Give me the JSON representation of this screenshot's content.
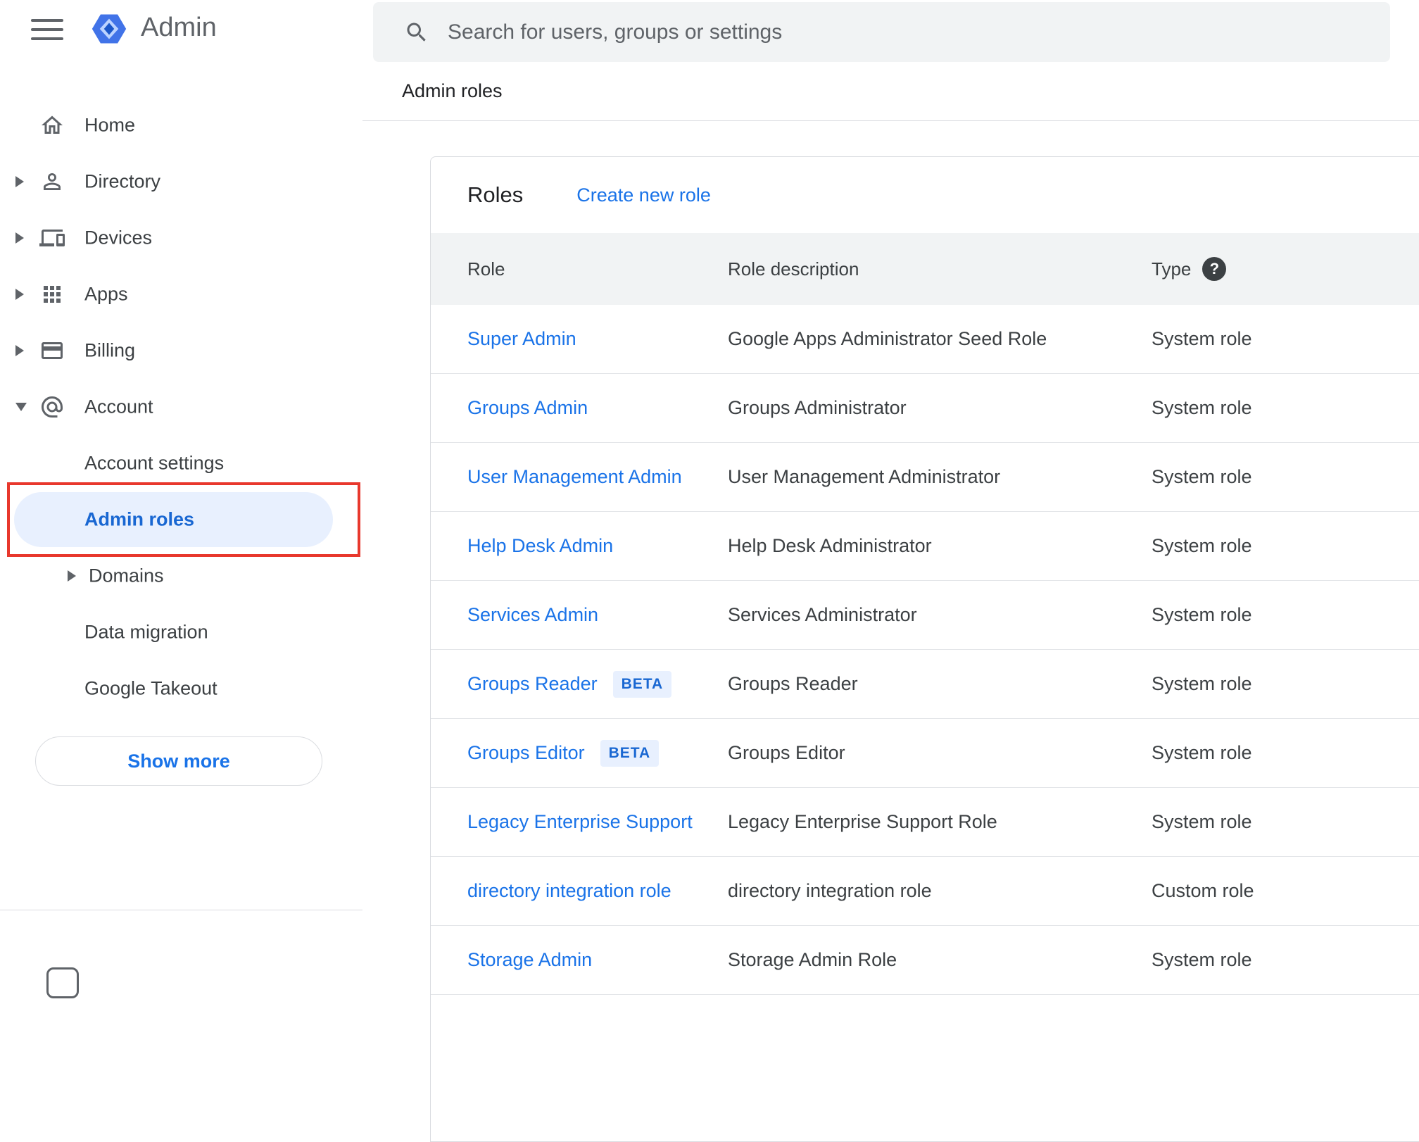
{
  "app": {
    "name": "Admin"
  },
  "search": {
    "placeholder": "Search for users, groups or settings"
  },
  "breadcrumb": "Admin roles",
  "sidebar": {
    "items": [
      {
        "label": "Home",
        "icon": "home"
      },
      {
        "label": "Directory",
        "icon": "person",
        "arrow": "right"
      },
      {
        "label": "Devices",
        "icon": "devices",
        "arrow": "right"
      },
      {
        "label": "Apps",
        "icon": "apps",
        "arrow": "right"
      },
      {
        "label": "Billing",
        "icon": "billing",
        "arrow": "right"
      },
      {
        "label": "Account",
        "icon": "at",
        "arrow": "down"
      },
      {
        "label": "Account settings",
        "indent": 1
      },
      {
        "label": "Admin roles",
        "indent": 1,
        "active": true,
        "annotated": true
      },
      {
        "label": "Domains",
        "indent": 1,
        "arrow": "right",
        "arrow_inner": true
      },
      {
        "label": "Data migration",
        "indent": 1
      },
      {
        "label": "Google Takeout",
        "indent": 1
      }
    ],
    "show_more": "Show more"
  },
  "roles": {
    "title": "Roles",
    "create_link": "Create new role",
    "columns": [
      "Role",
      "Role description",
      "Type"
    ],
    "help_glyph": "?",
    "beta_badge": "BETA",
    "rows": [
      {
        "role": "Super Admin",
        "beta": false,
        "description": "Google Apps Administrator Seed Role",
        "type": "System role"
      },
      {
        "role": "Groups Admin",
        "beta": false,
        "description": "Groups Administrator",
        "type": "System role"
      },
      {
        "role": "User Management Admin",
        "beta": false,
        "description": "User Management Administrator",
        "type": "System role"
      },
      {
        "role": "Help Desk Admin",
        "beta": false,
        "description": "Help Desk Administrator",
        "type": "System role"
      },
      {
        "role": "Services Admin",
        "beta": false,
        "description": "Services Administrator",
        "type": "System role"
      },
      {
        "role": "Groups Reader",
        "beta": true,
        "description": "Groups Reader",
        "type": "System role"
      },
      {
        "role": "Groups Editor",
        "beta": true,
        "description": "Groups Editor",
        "type": "System role"
      },
      {
        "role": "Legacy Enterprise Support",
        "beta": false,
        "description": "Legacy Enterprise Support Role",
        "type": "System role"
      },
      {
        "role": "directory integration role",
        "beta": false,
        "description": "directory integration role",
        "type": "Custom role"
      },
      {
        "role": "Storage Admin",
        "beta": false,
        "description": "Storage Admin Role",
        "type": "System role"
      }
    ]
  },
  "colors": {
    "link_blue": "#1a73e8",
    "active_blue": "#1967d2",
    "active_pill_bg": "#e8f0fe",
    "annotation_red": "#e8382d",
    "table_header_bg": "#f1f3f4",
    "search_bg": "#f1f3f4",
    "text_dark": "#202124",
    "text_gray": "#3c4043",
    "icon_gray": "#5f6368"
  }
}
